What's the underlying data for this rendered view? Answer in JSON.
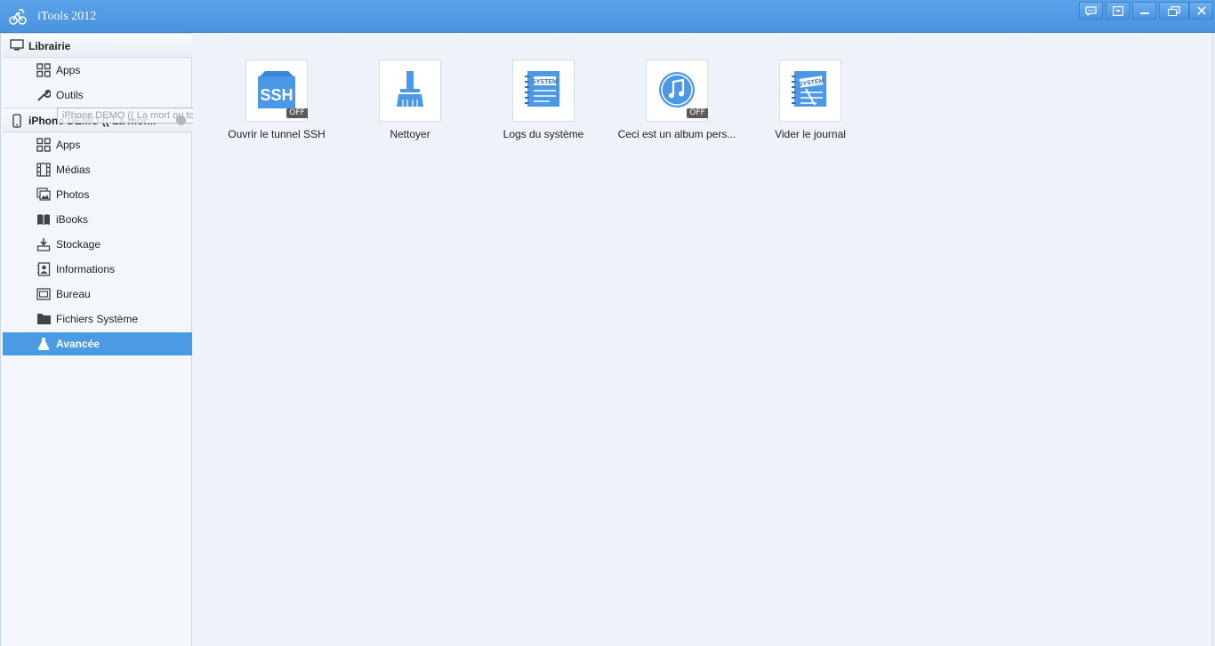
{
  "window": {
    "title": "iTools 2012",
    "controls": [
      "chat-icon",
      "dropdown-icon",
      "minimize-icon",
      "restore-icon",
      "close-icon"
    ]
  },
  "sidebar": {
    "library": {
      "label": "Librairie",
      "items": [
        {
          "label": "Apps",
          "icon": "grid-icon"
        },
        {
          "label": "Outils",
          "icon": "wrench-icon"
        }
      ]
    },
    "device": {
      "label": "iPhone DEMO (( La mor...",
      "tooltip": "iPhone DEMO (( La mort ou tchétché ) ??)",
      "items": [
        {
          "label": "Apps",
          "icon": "grid-icon"
        },
        {
          "label": "Médias",
          "icon": "film-icon"
        },
        {
          "label": "Photos",
          "icon": "photo-icon"
        },
        {
          "label": "iBooks",
          "icon": "book-icon"
        },
        {
          "label": "Stockage",
          "icon": "storage-icon"
        },
        {
          "label": "Informations",
          "icon": "contact-icon"
        },
        {
          "label": "Bureau",
          "icon": "desktop-icon"
        },
        {
          "label": "Fichiers Système",
          "icon": "folder-icon"
        },
        {
          "label": "Avancée",
          "icon": "flask-icon",
          "active": true
        }
      ]
    }
  },
  "tools": [
    {
      "label": "Ouvrir le tunnel SSH",
      "icon": "ssh-icon",
      "badge": "OFF",
      "icon_text": "SSH"
    },
    {
      "label": "Nettoyer",
      "icon": "broom-icon"
    },
    {
      "label": "Logs du système",
      "icon": "system-log-icon",
      "icon_text": "SYSTEM"
    },
    {
      "label": "Ceci est un album pers...",
      "icon": "music-note-icon",
      "badge": "OFF"
    },
    {
      "label": "Vider le journal",
      "icon": "system-clear-icon",
      "icon_text": "SYSTEM"
    }
  ],
  "colors": {
    "titlebar": "#4a92df",
    "accent": "#4a9be4",
    "icon_blue": "#4b98e6"
  }
}
